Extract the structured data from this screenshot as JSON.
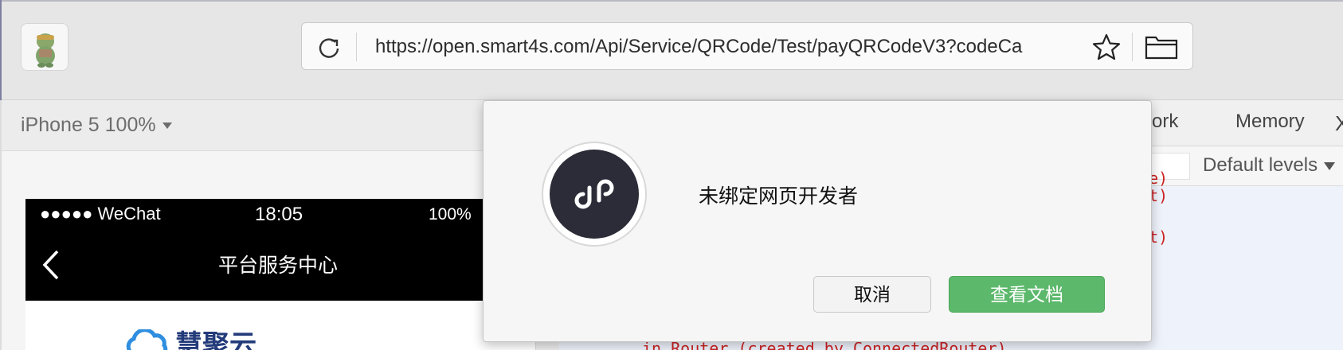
{
  "browser": {
    "url": "https://open.smart4s.com/Api/Service/QRCode/Test/payQRCodeV3?codeCa",
    "icons": [
      "app-logo-icon",
      "reload-icon",
      "star-icon",
      "folder-icon"
    ]
  },
  "simulator": {
    "device_label": "iPhone 5 100%",
    "status": {
      "carrier": "●●●●● WeChat",
      "time": "18:05",
      "battery": "100%"
    },
    "nav_title": "平台服务中心",
    "page_logo_text": "慧聚云"
  },
  "devtools": {
    "tabs": [
      "twork",
      "Memory"
    ],
    "close_label": "X",
    "levels_label": "Default levels",
    "console_lines": [
      "ite)",
      "out)",
      "ent)",
      "in Router (created by ConnectedRouter)"
    ]
  },
  "dialog": {
    "message": "未绑定网页开发者",
    "cancel_label": "取消",
    "docs_label": "查看文档",
    "colors": {
      "primary": "#5cb86b",
      "icon_bg": "#2b2c38"
    }
  }
}
